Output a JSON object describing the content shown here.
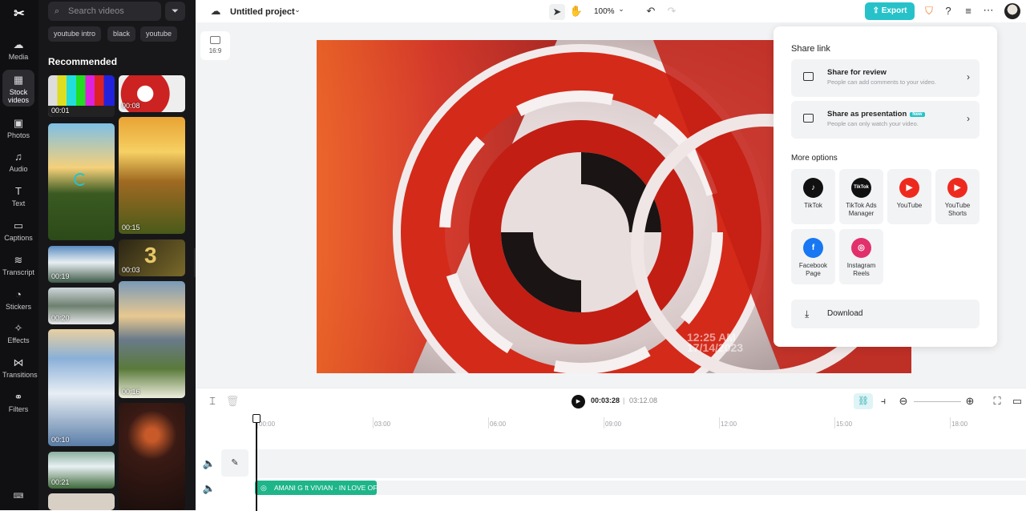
{
  "app": {
    "logo_glyph": "✂",
    "project_title": "Untitled project",
    "zoom": "100%",
    "export_label": "Export"
  },
  "sidebar": {
    "items": [
      {
        "label": "Media",
        "icon": "media-icon",
        "glyph": "☁"
      },
      {
        "label": "Stock videos",
        "icon": "film-icon",
        "glyph": "▦"
      },
      {
        "label": "Photos",
        "icon": "photo-icon",
        "glyph": "▣"
      },
      {
        "label": "Audio",
        "icon": "music-icon",
        "glyph": "♫"
      },
      {
        "label": "Text",
        "icon": "text-icon",
        "glyph": "T"
      },
      {
        "label": "Captions",
        "icon": "captions-icon",
        "glyph": "▭"
      },
      {
        "label": "Transcript",
        "icon": "transcript-icon",
        "glyph": "≋"
      },
      {
        "label": "Stickers",
        "icon": "sticker-icon",
        "glyph": "◔"
      },
      {
        "label": "Effects",
        "icon": "effects-icon",
        "glyph": "✧"
      },
      {
        "label": "Transitions",
        "icon": "transitions-icon",
        "glyph": "⋈"
      },
      {
        "label": "Filters",
        "icon": "filters-icon",
        "glyph": "⚭"
      }
    ]
  },
  "panel": {
    "search_placeholder": "Search videos",
    "chips": [
      "youtube intro",
      "black",
      "youtube"
    ],
    "section_title": "Recommended",
    "thumbnails": [
      {
        "duration": "00:01",
        "color": "#888"
      },
      {
        "duration": "00:08",
        "color": "#c33"
      },
      {
        "duration": "00:15",
        "color": "#b77a2a"
      },
      {
        "duration": "00:19",
        "color": "#4a6e8c"
      },
      {
        "duration": "00:03",
        "color": "#6a5a2a"
      },
      {
        "duration": "00:20",
        "color": "#8a9aa2"
      },
      {
        "duration": "00:16",
        "color": "#7a8898"
      },
      {
        "duration": "00:10",
        "color": "#6a8ab0"
      },
      {
        "duration": "00:21",
        "color": "#4e6e4a"
      }
    ]
  },
  "canvas": {
    "ratio": "16:9",
    "overlay_time": "12:25 AM",
    "overlay_date": "17/14/2023"
  },
  "share": {
    "title": "Share link",
    "review": {
      "title": "Share for review",
      "subtitle": "People can add comments to your video."
    },
    "presentation": {
      "title": "Share as presentation",
      "badge": "New",
      "subtitle": "People can only watch your video."
    },
    "more_title": "More options",
    "options": [
      {
        "label": "TikTok",
        "icon": "tiktok-icon",
        "glyph": "♪",
        "color": "#111111"
      },
      {
        "label": "TikTok Ads Manager",
        "icon": "tiktok-ads-icon",
        "glyph": "TikTok",
        "color": "#111111"
      },
      {
        "label": "YouTube",
        "icon": "youtube-icon",
        "glyph": "▶",
        "color": "#ee2a1f"
      },
      {
        "label": "YouTube Shorts",
        "icon": "youtube-shorts-icon",
        "glyph": "▶",
        "color": "#ee2a1f"
      },
      {
        "label": "Facebook Page",
        "icon": "facebook-icon",
        "glyph": "f",
        "color": "#1877f2"
      },
      {
        "label": "Instagram Reels",
        "icon": "instagram-icon",
        "glyph": "◎",
        "color": "#e1306c"
      }
    ],
    "download_label": "Download"
  },
  "timeline": {
    "current_time": "00:03:28",
    "total_time": "03:12.08",
    "ruler": [
      "00:00",
      "03:00",
      "06:00",
      "09:00",
      "12:00",
      "15:00",
      "18:00"
    ],
    "audio_clip": "AMANI G ft VIVIAN - IN LOVE OFI"
  },
  "colors": {
    "accent": "#27c2c9",
    "audio_clip": "#1eb58a"
  }
}
